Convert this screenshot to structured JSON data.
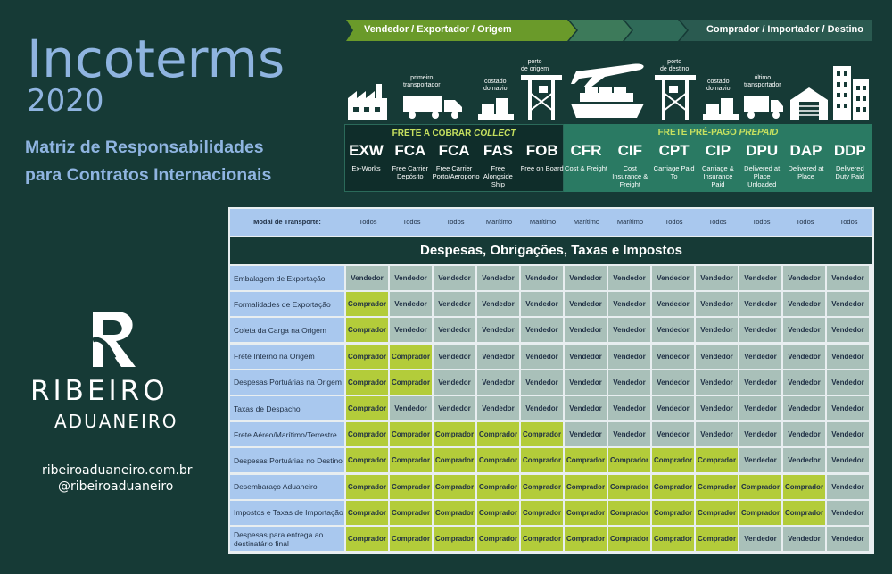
{
  "header": {
    "title": "Incoterms",
    "year": "2020",
    "subtitle_line1": "Matriz de Responsabilidades",
    "subtitle_line2": "para Contratos Internacionais"
  },
  "brand": {
    "name": "RIBEIRO",
    "tagline": "ADUANEIRO",
    "website": "ribeiroaduaneiro.com.br",
    "handle": "@ribeiroaduaneiro"
  },
  "arrow": {
    "seller_label": "Vendedor / Exportador / Origem",
    "buyer_label": "Comprador / Importador / Destino"
  },
  "icons": [
    {
      "name": "factory-icon",
      "caption": ""
    },
    {
      "name": "truck-icon",
      "caption": "primeiro\ntransportador"
    },
    {
      "name": "boxes-icon",
      "caption": "costado\ndo navio"
    },
    {
      "name": "crane-icon",
      "caption": "porto\nde origem"
    },
    {
      "name": "ship-plane-icon",
      "caption": ""
    },
    {
      "name": "crane-icon",
      "caption": "porto\nde destino"
    },
    {
      "name": "boxes-icon",
      "caption": "costado\ndo navio"
    },
    {
      "name": "truck-icon",
      "caption": "último\ntransportador"
    },
    {
      "name": "warehouse-icon",
      "caption": ""
    },
    {
      "name": "buildings-icon",
      "caption": ""
    }
  ],
  "bands": {
    "collect_prefix": "FRETE A COBRAR",
    "collect_italic": "COLLECT",
    "prepaid_prefix": "FRETE PRÉ-PAGO",
    "prepaid_italic": "PREPAID"
  },
  "terms": [
    {
      "code": "EXW",
      "desc": "Ex-Works"
    },
    {
      "code": "FCA",
      "desc": "Free Carrier Depósito"
    },
    {
      "code": "FCA",
      "desc": "Free Carrier Porto/Aeroporto"
    },
    {
      "code": "FAS",
      "desc": "Free Alongside Ship"
    },
    {
      "code": "FOB",
      "desc": "Free on Board"
    },
    {
      "code": "CFR",
      "desc": "Cost & Freight"
    },
    {
      "code": "CIF",
      "desc": "Cost Insurance & Freight"
    },
    {
      "code": "CPT",
      "desc": "Carriage Paid To"
    },
    {
      "code": "CIP",
      "desc": "Carriage & Insurance Paid"
    },
    {
      "code": "DPU",
      "desc": "Delivered at Place Unloaded"
    },
    {
      "code": "DAP",
      "desc": "Delivered at Place"
    },
    {
      "code": "DDP",
      "desc": "Delivered Duty Paid"
    }
  ],
  "table": {
    "modal_label": "Modal de Transporte:",
    "modal": [
      "Todos",
      "Todos",
      "Todos",
      "Marítimo",
      "Marítimo",
      "Marítimo",
      "Marítimo",
      "Todos",
      "Todos",
      "Todos",
      "Todos",
      "Todos"
    ],
    "section_title": "Despesas, Obrigações, Taxas e Impostos",
    "rows": [
      {
        "label": "Embalagem de Exportação",
        "cells": [
          "Vendedor",
          "Vendedor",
          "Vendedor",
          "Vendedor",
          "Vendedor",
          "Vendedor",
          "Vendedor",
          "Vendedor",
          "Vendedor",
          "Vendedor",
          "Vendedor",
          "Vendedor"
        ]
      },
      {
        "label": "Formalidades de Exportação",
        "cells": [
          "Comprador",
          "Vendedor",
          "Vendedor",
          "Vendedor",
          "Vendedor",
          "Vendedor",
          "Vendedor",
          "Vendedor",
          "Vendedor",
          "Vendedor",
          "Vendedor",
          "Vendedor"
        ]
      },
      {
        "label": "Coleta da Carga na Origem",
        "cells": [
          "Comprador",
          "Vendedor",
          "Vendedor",
          "Vendedor",
          "Vendedor",
          "Vendedor",
          "Vendedor",
          "Vendedor",
          "Vendedor",
          "Vendedor",
          "Vendedor",
          "Vendedor"
        ]
      },
      {
        "label": "Frete Interno na Origem",
        "cells": [
          "Comprador",
          "Comprador",
          "Vendedor",
          "Vendedor",
          "Vendedor",
          "Vendedor",
          "Vendedor",
          "Vendedor",
          "Vendedor",
          "Vendedor",
          "Vendedor",
          "Vendedor"
        ]
      },
      {
        "label": "Despesas Portuárias na Origem",
        "cells": [
          "Comprador",
          "Comprador",
          "Vendedor",
          "Vendedor",
          "Vendedor",
          "Vendedor",
          "Vendedor",
          "Vendedor",
          "Vendedor",
          "Vendedor",
          "Vendedor",
          "Vendedor"
        ]
      },
      {
        "label": "Taxas de Despacho",
        "cells": [
          "Comprador",
          "Vendedor",
          "Vendedor",
          "Vendedor",
          "Vendedor",
          "Vendedor",
          "Vendedor",
          "Vendedor",
          "Vendedor",
          "Vendedor",
          "Vendedor",
          "Vendedor"
        ]
      },
      {
        "label": "Frete Aéreo/Marítimo/Terrestre",
        "cells": [
          "Comprador",
          "Comprador",
          "Comprador",
          "Comprador",
          "Comprador",
          "Vendedor",
          "Vendedor",
          "Vendedor",
          "Vendedor",
          "Vendedor",
          "Vendedor",
          "Vendedor"
        ]
      },
      {
        "label": "Despesas Portuárias no Destino",
        "cells": [
          "Comprador",
          "Comprador",
          "Comprador",
          "Comprador",
          "Comprador",
          "Comprador",
          "Comprador",
          "Comprador",
          "Comprador",
          "Vendedor",
          "Vendedor",
          "Vendedor"
        ]
      },
      {
        "label": "Desembaraço Aduaneiro",
        "cells": [
          "Comprador",
          "Comprador",
          "Comprador",
          "Comprador",
          "Comprador",
          "Comprador",
          "Comprador",
          "Comprador",
          "Comprador",
          "Comprador",
          "Comprador",
          "Vendedor"
        ]
      },
      {
        "label": "Impostos e Taxas de Importação",
        "cells": [
          "Comprador",
          "Comprador",
          "Comprador",
          "Comprador",
          "Comprador",
          "Comprador",
          "Comprador",
          "Comprador",
          "Comprador",
          "Comprador",
          "Comprador",
          "Vendedor"
        ]
      },
      {
        "label": "Despesas para entrega ao destinatário final",
        "cells": [
          "Comprador",
          "Comprador",
          "Comprador",
          "Comprador",
          "Comprador",
          "Comprador",
          "Comprador",
          "Comprador",
          "Comprador",
          "Vendedor",
          "Vendedor",
          "Vendedor"
        ]
      }
    ]
  },
  "colors": {
    "background": "#163a36",
    "title_blue": "#8fb4e0",
    "seller_cell": "#a9c0b9",
    "buyer_cell": "#b3cc3a",
    "label_blue": "#a9c8ee",
    "arrow_green": "#6a9a2a",
    "arrow_dark": "#2a5a50"
  }
}
